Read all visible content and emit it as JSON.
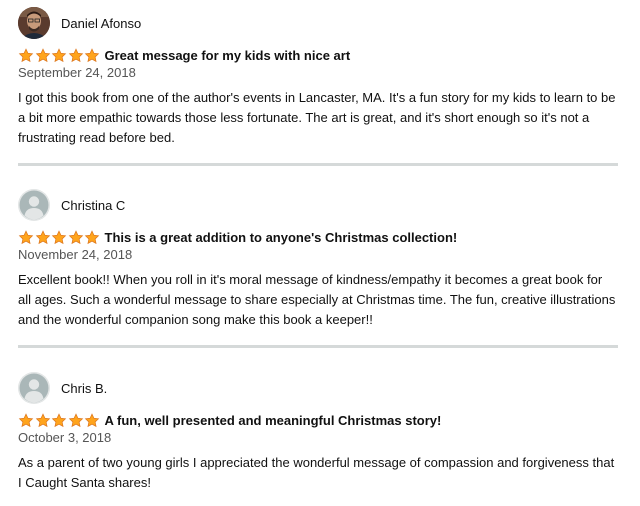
{
  "reviews": [
    {
      "author": "Daniel Afonso",
      "avatar_icon": "profile-photo",
      "rating": 5,
      "title": "Great message for my kids with nice art",
      "date": "September 24, 2018",
      "body": "I got this book from one of the author's events in Lancaster, MA. It's a fun story for my kids to learn to be a bit more empathic towards those less fortunate. The art is great, and it's short enough so it's not a frustrating read before bed."
    },
    {
      "author": "Christina C",
      "avatar_icon": "default-user-icon",
      "rating": 5,
      "title": "This is a great addition to anyone's Christmas collection!",
      "date": "November 24, 2018",
      "body": "Excellent book!! When you roll in it's moral message of kindness/empathy it becomes a great book for all ages. Such a wonderful message to share especially at Christmas time. The fun, creative illustrations and the wonderful companion song make this book a keeper!!"
    },
    {
      "author": "Chris B.",
      "avatar_icon": "default-user-icon",
      "rating": 5,
      "title": "A fun, well presented and meaningful Christmas story!",
      "date": "October 3, 2018",
      "body": "As a parent of two young girls I appreciated the wonderful message of compassion and forgiveness that I Caught Santa shares!"
    }
  ],
  "colors": {
    "star_fill": "#ffa41c",
    "star_stroke": "#de7921",
    "divider": "#d5d9d9",
    "date": "#555555"
  }
}
